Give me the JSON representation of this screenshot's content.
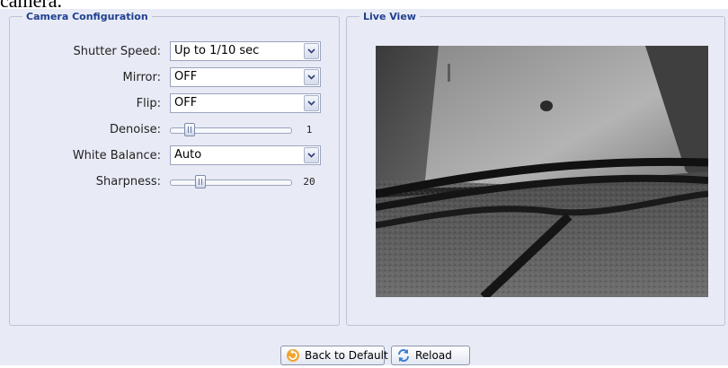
{
  "caption": "camera.",
  "camera_config": {
    "title": "Camera Configuration",
    "shutter_speed": {
      "label": "Shutter Speed:",
      "value": "Up to 1/10 sec"
    },
    "mirror": {
      "label": "Mirror:",
      "value": "OFF"
    },
    "flip": {
      "label": "Flip:",
      "value": "OFF"
    },
    "denoise": {
      "label": "Denoise:",
      "value": "1",
      "level": 0.1
    },
    "white_balance": {
      "label": "White Balance:",
      "value": "Auto"
    },
    "sharpness": {
      "label": "Sharpness:",
      "value": "20",
      "level": 0.2
    }
  },
  "live_view": {
    "title": "Live View"
  },
  "buttons": {
    "back_to_default": "Back to Default",
    "reload": "Reload"
  },
  "colors": {
    "panel_background": "#e8ebf5",
    "legend_text": "#1f3f8f",
    "border": "#bcc3d6"
  },
  "icons": {
    "dropdown": "chevron-down-icon",
    "back_to_default": "undo-arrow-icon",
    "reload": "refresh-icon"
  }
}
